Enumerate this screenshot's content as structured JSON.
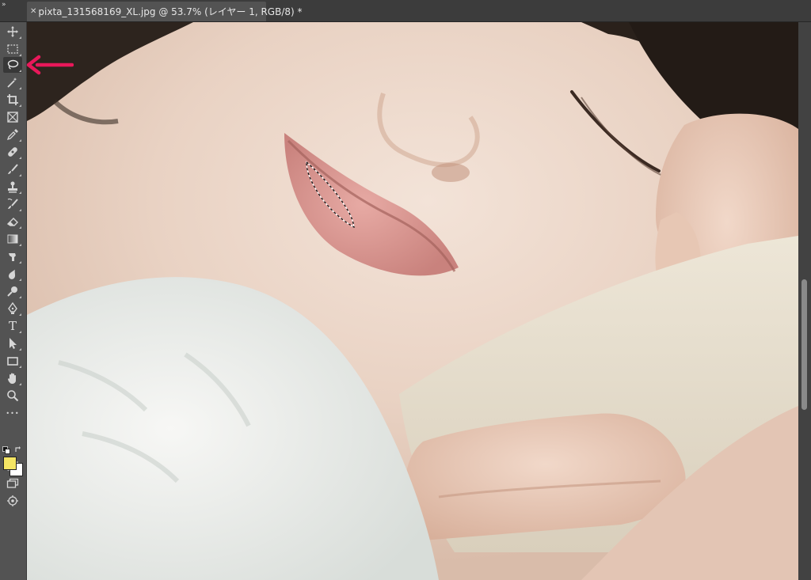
{
  "document": {
    "tab_title": "pixta_131568169_XL.jpg @ 53.7% (レイヤー 1, RGB/8) *",
    "close_glyph": "✕",
    "panel_expand_glyph": "»"
  },
  "toolbar": {
    "tools": [
      {
        "id": "move",
        "icon": "move-icon"
      },
      {
        "id": "marquee",
        "icon": "rect-marquee-icon"
      },
      {
        "id": "lasso",
        "icon": "lasso-icon",
        "active": true
      },
      {
        "id": "magic-wand",
        "icon": "magic-wand-icon"
      },
      {
        "id": "crop",
        "icon": "crop-icon"
      },
      {
        "id": "frame",
        "icon": "frame-icon"
      },
      {
        "id": "eyedropper",
        "icon": "eyedropper-icon"
      },
      {
        "id": "healing",
        "icon": "healing-brush-icon"
      },
      {
        "id": "brush",
        "icon": "brush-icon"
      },
      {
        "id": "stamp",
        "icon": "clone-stamp-icon"
      },
      {
        "id": "history-brush",
        "icon": "history-brush-icon"
      },
      {
        "id": "eraser",
        "icon": "eraser-icon"
      },
      {
        "id": "gradient",
        "icon": "gradient-icon"
      },
      {
        "id": "smudge",
        "icon": "smudge-icon"
      },
      {
        "id": "blur",
        "icon": "blur-icon"
      },
      {
        "id": "dodge",
        "icon": "dodge-icon"
      },
      {
        "id": "pen",
        "icon": "pen-icon"
      },
      {
        "id": "type",
        "icon": "type-icon",
        "label": "T"
      },
      {
        "id": "path-select",
        "icon": "path-selection-icon"
      },
      {
        "id": "rectangle",
        "icon": "rectangle-shape-icon"
      },
      {
        "id": "hand",
        "icon": "hand-icon"
      },
      {
        "id": "zoom",
        "icon": "zoom-icon"
      },
      {
        "id": "more",
        "icon": "more-tools-icon",
        "label": "•••"
      }
    ],
    "foreground_color": "#f4e564",
    "background_color": "#ffffff"
  },
  "colors": {
    "app_bg": "#535353",
    "annotation_arrow": "#e8185a"
  }
}
